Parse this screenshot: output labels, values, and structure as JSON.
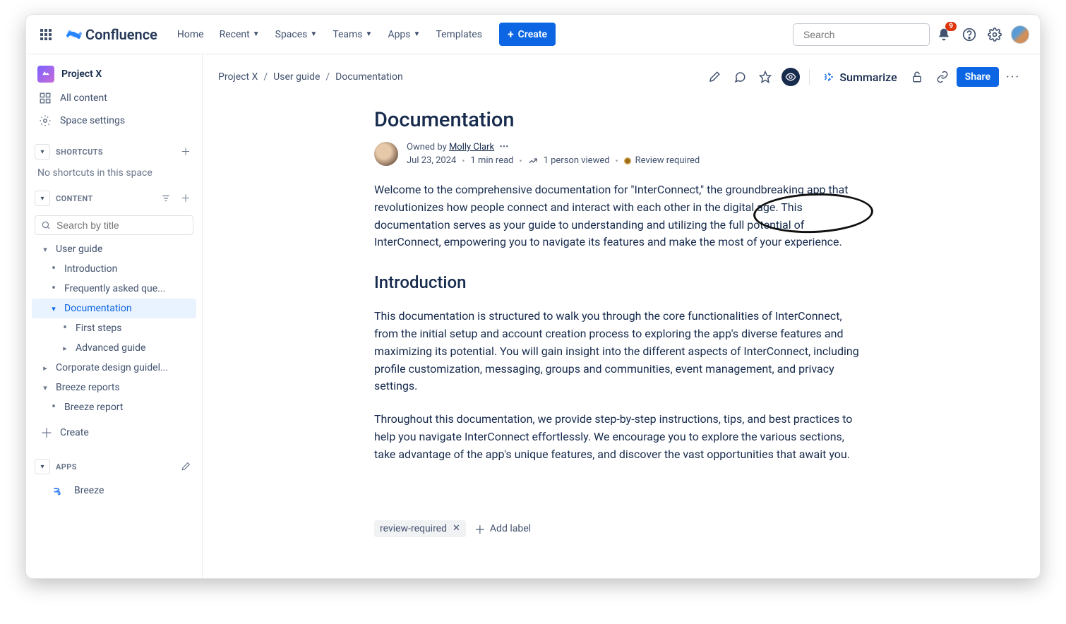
{
  "top": {
    "product": "Confluence",
    "links": [
      "Home",
      "Recent",
      "Spaces",
      "Teams",
      "Apps",
      "Templates"
    ],
    "createLabel": "Create",
    "searchPlaceholder": "Search",
    "notifCount": "9"
  },
  "sidebar": {
    "spaceName": "Project X",
    "allContent": "All content",
    "spaceSettings": "Space settings",
    "shortcutsLabel": "SHORTCUTS",
    "shortcutsHint": "No shortcuts in this space",
    "contentLabel": "CONTENT",
    "titleSearchPlaceholder": "Search by title",
    "tree": {
      "userGuide": "User guide",
      "introduction": "Introduction",
      "faq": "Frequently asked que...",
      "documentation": "Documentation",
      "firstSteps": "First steps",
      "advancedGuide": "Advanced guide",
      "corpDesign": "Corporate design guidel...",
      "breezeReports": "Breeze reports",
      "breezeReport": "Breeze report"
    },
    "createLabel": "Create",
    "appsLabel": "APPS",
    "breezeApp": "Breeze"
  },
  "crumbs": [
    "Project X",
    "User guide",
    "Documentation"
  ],
  "pageActions": {
    "summarize": "Summarize",
    "share": "Share"
  },
  "page": {
    "title": "Documentation",
    "ownedByPrefix": "Owned by ",
    "author": "Molly Clark",
    "date": "Jul 23, 2024",
    "readTime": "1 min read",
    "viewCount": "1 person viewed",
    "status": "Review required",
    "para1": "Welcome to the comprehensive documentation for \"InterConnect,\" the groundbreaking app that revolutionizes how people connect and interact with each other in the digital age. This documentation serves as your guide to understanding and utilizing the full potential of InterConnect, empowering you to navigate its features and make the most of your experience.",
    "h2": "Introduction",
    "para2": "This documentation is structured to walk you through the core functionalities of InterConnect, from the initial setup and account creation process to exploring the app's diverse features and maximizing its potential. You will gain insight into the different aspects of InterConnect, including profile customization, messaging, groups and communities, event management, and privacy settings.",
    "para3": "Throughout this documentation, we provide step-by-step instructions, tips, and best practices to help you navigate InterConnect effortlessly. We encourage you to explore the various sections, take advantage of the app's unique features, and discover the vast opportunities that await you."
  },
  "labels": {
    "chip": "review-required",
    "addLabel": "Add label"
  }
}
